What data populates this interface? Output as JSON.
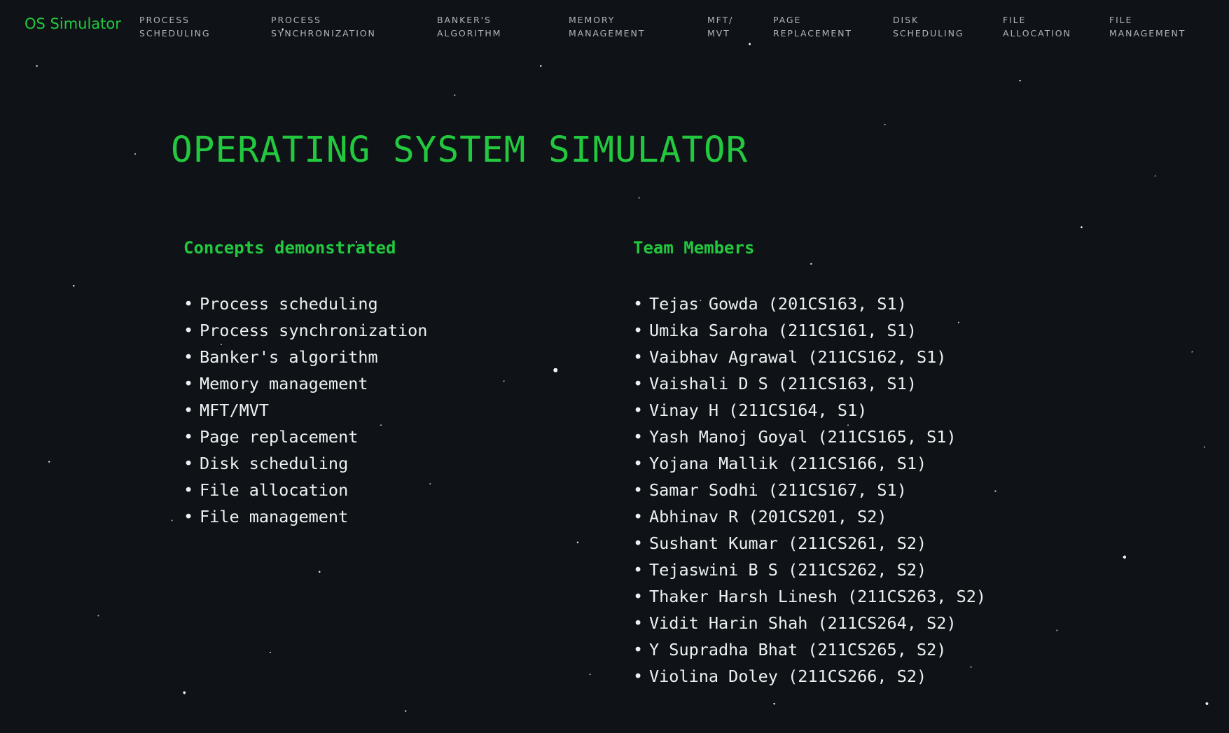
{
  "nav": {
    "brand": "OS Simulator",
    "links": [
      {
        "line1": "PROCESS",
        "line2": "SCHEDULING"
      },
      {
        "line1": "PROCESS",
        "line2": "SYNCHRONIZATION"
      },
      {
        "line1": "BANKER'S",
        "line2": "ALGORITHM"
      },
      {
        "line1": "MEMORY",
        "line2": "MANAGEMENT"
      },
      {
        "line1": "MFT/",
        "line2": "MVT"
      },
      {
        "line1": "PAGE",
        "line2": "REPLACEMENT"
      },
      {
        "line1": "DISK",
        "line2": "SCHEDULING"
      },
      {
        "line1": "FILE",
        "line2": "ALLOCATION"
      },
      {
        "line1": "FILE",
        "line2": "MANAGEMENT"
      }
    ]
  },
  "main": {
    "title": "OPERATING SYSTEM SIMULATOR",
    "concepts": {
      "heading": "Concepts demonstrated",
      "items": [
        "Process scheduling",
        "Process synchronization",
        "Banker's algorithm",
        "Memory management",
        "MFT/MVT",
        "Page replacement",
        "Disk scheduling",
        "File allocation",
        "File management"
      ]
    },
    "team": {
      "heading": "Team Members",
      "members": [
        "Tejas Gowda (201CS163, S1)",
        "Umika Saroha (211CS161, S1)",
        "Vaibhav Agrawal (211CS162, S1)",
        "Vaishali D S (211CS163, S1)",
        "Vinay H (211CS164, S1)",
        "Yash Manoj Goyal (211CS165, S1)",
        "Yojana Mallik (211CS166, S1)",
        "Samar Sodhi (211CS167, S1)",
        "Abhinav R (201CS201, S2)",
        "Sushant Kumar (211CS261, S2)",
        "Tejaswini B S (211CS262, S2)",
        "Thaker Harsh Linesh (211CS263, S2)",
        "Vidit Harin Shah (211CS264, S2)",
        "Y Supradha Bhat (211CS265, S2)",
        "Violina Doley (211CS266, S2)"
      ]
    }
  },
  "colors": {
    "accent_green": "#22c93f",
    "background": "#0f1216",
    "nav_text": "#aeb6bd",
    "body_text": "#eef1f3"
  }
}
